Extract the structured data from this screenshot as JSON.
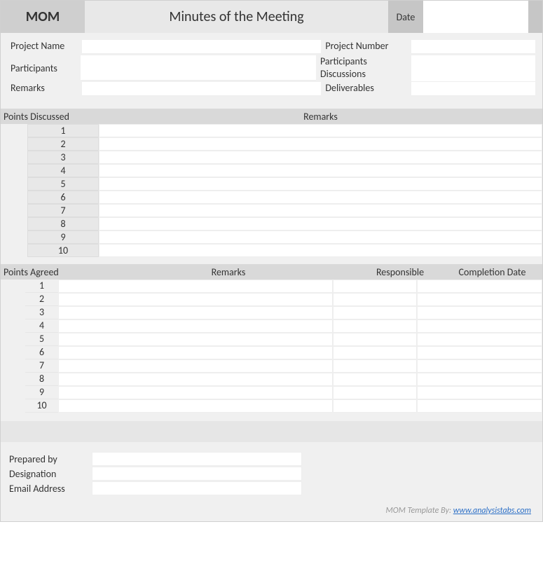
{
  "header": {
    "short": "MOM",
    "title": "Minutes of the Meeting",
    "date_label": "Date",
    "date_value": ""
  },
  "info": {
    "left": {
      "project_name_label": "Project Name",
      "project_name_value": "",
      "participants_label": "Participants",
      "participants_value": "",
      "remarks_label": "Remarks",
      "remarks_value": ""
    },
    "right": {
      "project_number_label": "Project Number",
      "project_number_value": "",
      "participants_label": "Participants",
      "participants_value": "",
      "discussions_label": "Discussions",
      "discussions_value": "",
      "deliverables_label": "Deliverables",
      "deliverables_value": ""
    }
  },
  "discussed": {
    "header_points": "Points Discussed",
    "header_remarks": "Remarks",
    "rows": [
      {
        "num": "1",
        "remarks": ""
      },
      {
        "num": "2",
        "remarks": ""
      },
      {
        "num": "3",
        "remarks": ""
      },
      {
        "num": "4",
        "remarks": ""
      },
      {
        "num": "5",
        "remarks": ""
      },
      {
        "num": "6",
        "remarks": ""
      },
      {
        "num": "7",
        "remarks": ""
      },
      {
        "num": "8",
        "remarks": ""
      },
      {
        "num": "9",
        "remarks": ""
      },
      {
        "num": "10",
        "remarks": ""
      }
    ]
  },
  "agreed": {
    "header_points": "Points Agreed",
    "header_remarks": "Remarks",
    "header_responsible": "Responsible",
    "header_completion": "Completion Date",
    "rows": [
      {
        "num": "1",
        "remarks": "",
        "responsible": "",
        "completion": ""
      },
      {
        "num": "2",
        "remarks": "",
        "responsible": "",
        "completion": ""
      },
      {
        "num": "3",
        "remarks": "",
        "responsible": "",
        "completion": ""
      },
      {
        "num": "4",
        "remarks": "",
        "responsible": "",
        "completion": ""
      },
      {
        "num": "5",
        "remarks": "",
        "responsible": "",
        "completion": ""
      },
      {
        "num": "6",
        "remarks": "",
        "responsible": "",
        "completion": ""
      },
      {
        "num": "7",
        "remarks": "",
        "responsible": "",
        "completion": ""
      },
      {
        "num": "8",
        "remarks": "",
        "responsible": "",
        "completion": ""
      },
      {
        "num": "9",
        "remarks": "",
        "responsible": "",
        "completion": ""
      },
      {
        "num": "10",
        "remarks": "",
        "responsible": "",
        "completion": ""
      }
    ]
  },
  "footer": {
    "prepared_by_label": "Prepared by",
    "prepared_by_value": "",
    "designation_label": "Designation",
    "designation_value": "",
    "email_label": "Email Address",
    "email_value": ""
  },
  "credit": {
    "prefix": "MOM Template By:  ",
    "link_text": "www.analysistabs.com"
  }
}
